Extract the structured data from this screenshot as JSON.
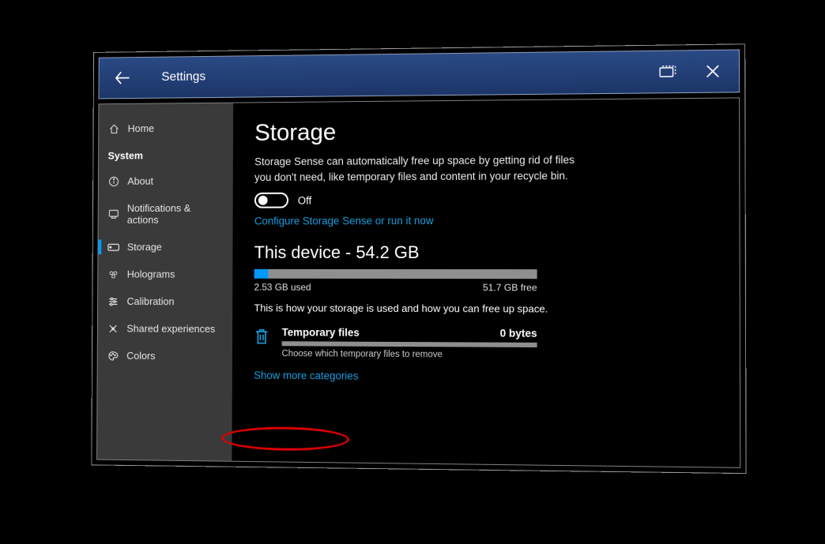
{
  "titlebar": {
    "title": "Settings"
  },
  "sidebar": {
    "home": "Home",
    "section": "System",
    "items": [
      {
        "icon": "info",
        "label": "About"
      },
      {
        "icon": "notif",
        "label": "Notifications & actions"
      },
      {
        "icon": "storage",
        "label": "Storage"
      },
      {
        "icon": "holo",
        "label": "Holograms"
      },
      {
        "icon": "calib",
        "label": "Calibration"
      },
      {
        "icon": "shared",
        "label": "Shared experiences"
      },
      {
        "icon": "colors",
        "label": "Colors"
      }
    ],
    "selected_index": 2
  },
  "content": {
    "heading": "Storage",
    "description": "Storage Sense can automatically free up space by getting rid of files you don't need, like temporary files and content in your recycle bin.",
    "toggle_state": "Off",
    "configure_link": "Configure Storage Sense or run it now",
    "device_heading": "This device - 54.2 GB",
    "used_label": "2.53 GB used",
    "free_label": "51.7 GB free",
    "used_fraction_percent": 5,
    "hint": "This is how your storage is used and how you can free up space.",
    "category": {
      "name": "Temporary files",
      "size": "0 bytes",
      "sub": "Choose which temporary files to remove"
    },
    "show_more": "Show more categories"
  },
  "colors": {
    "accent": "#0099ff",
    "link": "#1a9fe0"
  }
}
